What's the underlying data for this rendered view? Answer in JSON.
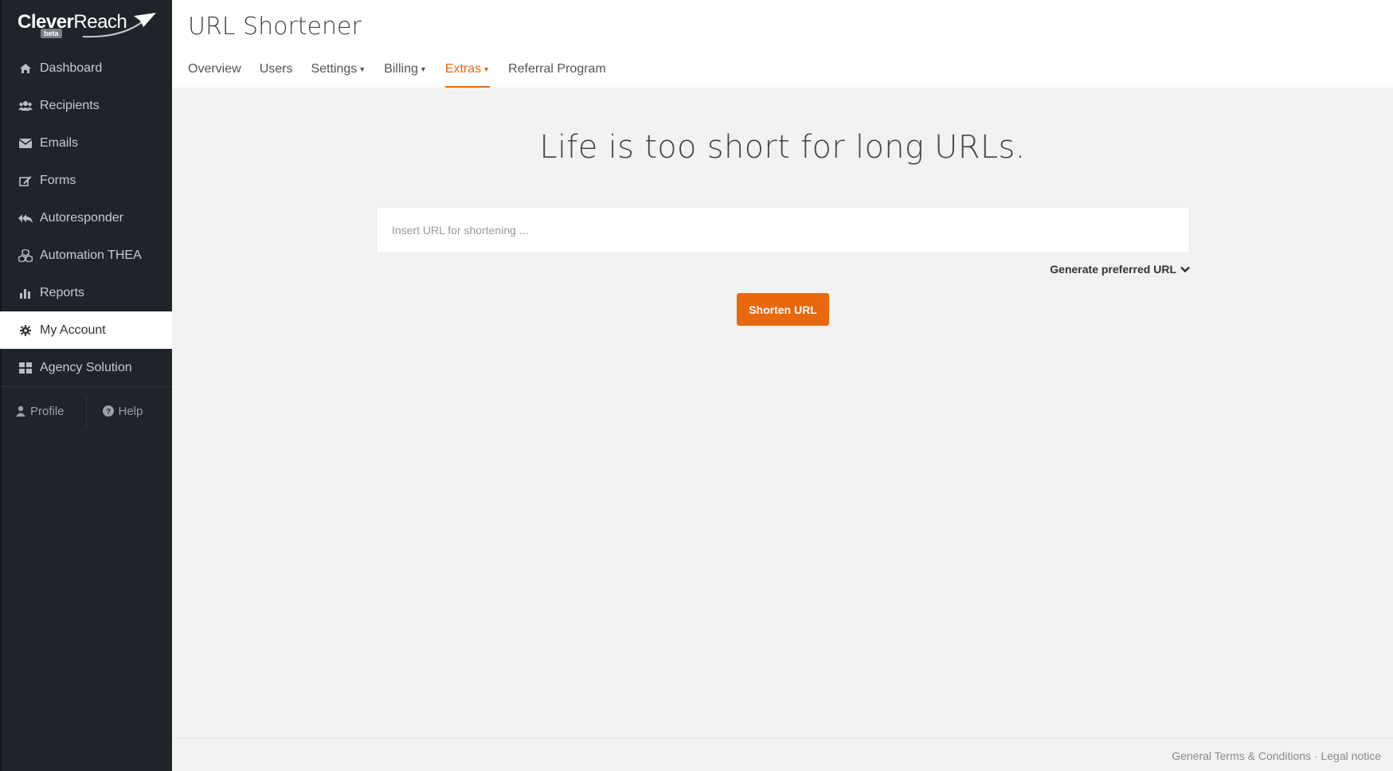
{
  "brand": {
    "name_bold": "Clever",
    "name_regular": "Reach",
    "beta": "beta"
  },
  "colors": {
    "accent": "#e8680d",
    "sidebar_bg": "#1f242b"
  },
  "sidebar": {
    "items": [
      {
        "label": "Dashboard",
        "icon": "home-icon"
      },
      {
        "label": "Recipients",
        "icon": "users-icon"
      },
      {
        "label": "Emails",
        "icon": "envelope-icon"
      },
      {
        "label": "Forms",
        "icon": "edit-icon"
      },
      {
        "label": "Autoresponder",
        "icon": "reply-all-icon"
      },
      {
        "label": "Automation THEA",
        "icon": "cubes-icon"
      },
      {
        "label": "Reports",
        "icon": "bar-chart-icon"
      },
      {
        "label": "My Account",
        "icon": "gear-icon",
        "active": true
      },
      {
        "label": "Agency Solution",
        "icon": "grid-icon"
      }
    ],
    "bottom": {
      "profile": "Profile",
      "help": "Help"
    }
  },
  "header": {
    "title": "URL Shortener",
    "tabs": [
      {
        "label": "Overview"
      },
      {
        "label": "Users"
      },
      {
        "label": "Settings",
        "dropdown": true
      },
      {
        "label": "Billing",
        "dropdown": true
      },
      {
        "label": "Extras",
        "dropdown": true,
        "active": true
      },
      {
        "label": "Referral Program"
      }
    ]
  },
  "main": {
    "headline": "Life is too short for long URLs.",
    "input_placeholder": "Insert URL for shortening ...",
    "input_value": "",
    "generate_label": "Generate preferred URL",
    "button_label": "Shorten URL"
  },
  "footer": {
    "terms": "General Terms & Conditions",
    "separator": "·",
    "legal": "Legal notice"
  }
}
